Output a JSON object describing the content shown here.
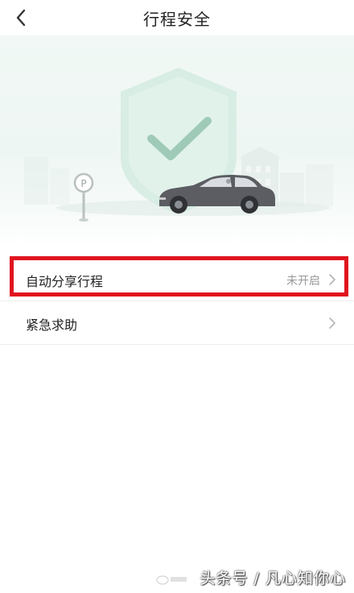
{
  "header": {
    "title": "行程安全",
    "back_icon": "chevron-left-icon"
  },
  "hero": {
    "illustration": "safety-shield-car-illustration"
  },
  "settings": [
    {
      "label": "自动分享行程",
      "value": "未开启",
      "icon": "chevron-right-icon",
      "highlighted": true
    },
    {
      "label": "紧急求助",
      "value": "",
      "icon": "chevron-right-icon",
      "highlighted": false
    }
  ],
  "colors": {
    "highlight": "#e0141e",
    "hero_bg": "#eef6f3",
    "shield": "#dbeee6",
    "check": "#a9cfc0",
    "car": "#5a5c60"
  },
  "watermark": {
    "text": "头条号 / 凡心知你心"
  }
}
